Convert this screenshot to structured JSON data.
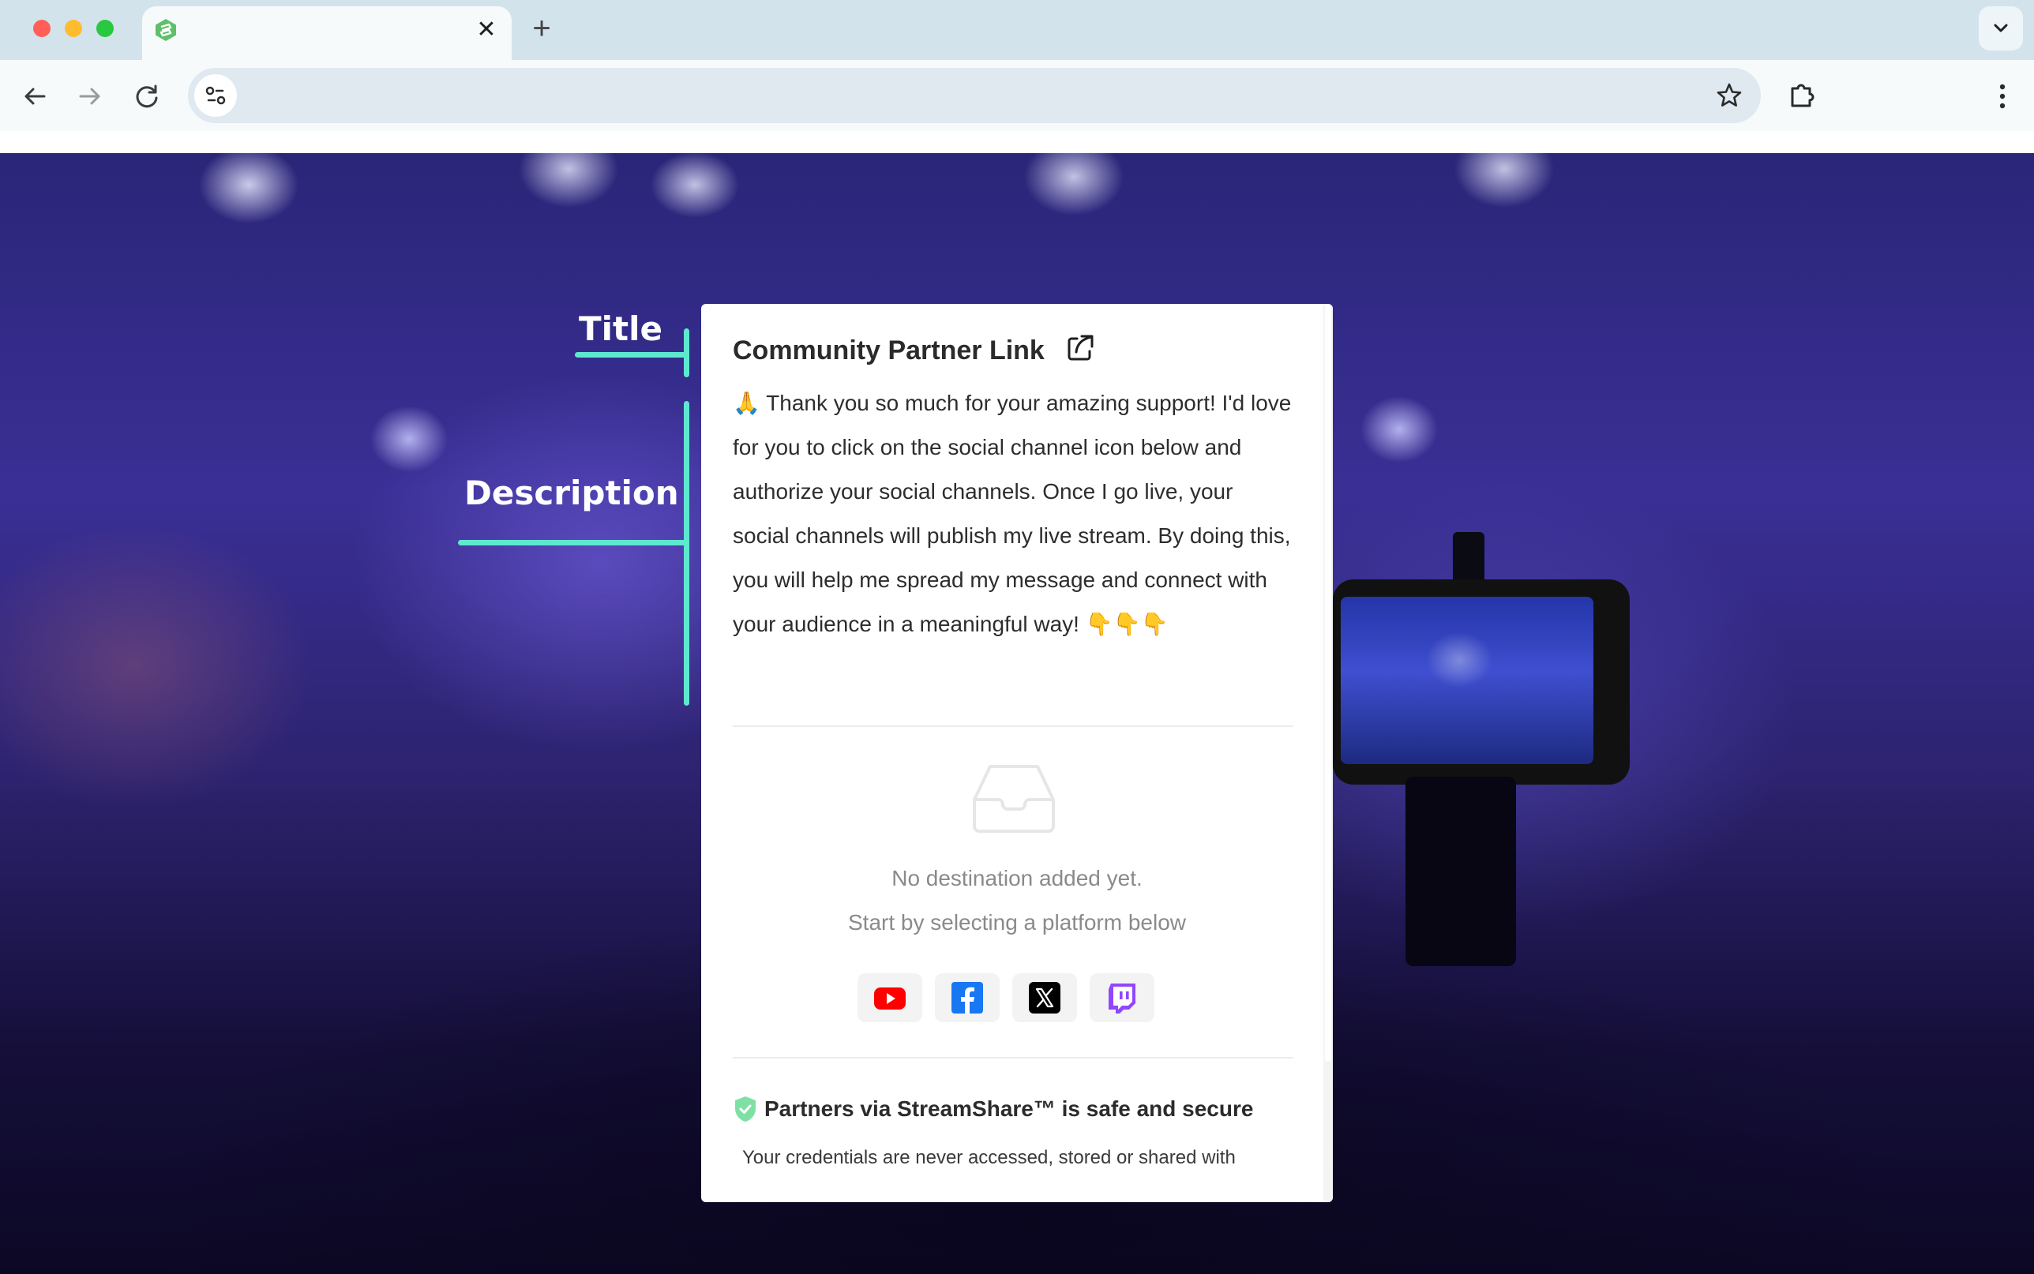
{
  "browser": {
    "tab_title": "",
    "tab_close_glyph": "✕",
    "new_tab_glyph": "+",
    "url": ""
  },
  "annotations": {
    "title_label": "Title",
    "description_label": "Description",
    "color": "#5ee8cf"
  },
  "card": {
    "title": "Community Partner Link",
    "description": "🙏 Thank you so much for your amazing support! I'd love for you to click on the social channel icon below and authorize your social channels. Once I go live, your social channels will publish my live stream. By doing this, you will help me spread my message and connect with your audience in a meaningful way! 👇👇👇",
    "empty_state": {
      "line1": "No destination added yet.",
      "line2": "Start by selecting a platform below"
    },
    "platforms": [
      {
        "name": "youtube-icon",
        "color": "#ff0000"
      },
      {
        "name": "facebook-icon",
        "color": "#1877f2"
      },
      {
        "name": "x-icon",
        "color": "#000000"
      },
      {
        "name": "twitch-icon",
        "color": "#9146ff"
      }
    ],
    "security": {
      "heading": "Partners via StreamShare™ is safe and secure",
      "subtext": "Your credentials are never accessed, stored or shared with"
    }
  },
  "icons": {
    "back": "arrow-left-icon",
    "forward": "arrow-right-icon",
    "reload": "reload-icon",
    "site_info": "tune-icon",
    "bookmark": "star-icon",
    "extensions": "puzzle-icon",
    "menu": "kebab-menu-icon",
    "share": "share-icon",
    "inbox": "inbox-tray-icon",
    "shield": "shield-check-icon"
  }
}
